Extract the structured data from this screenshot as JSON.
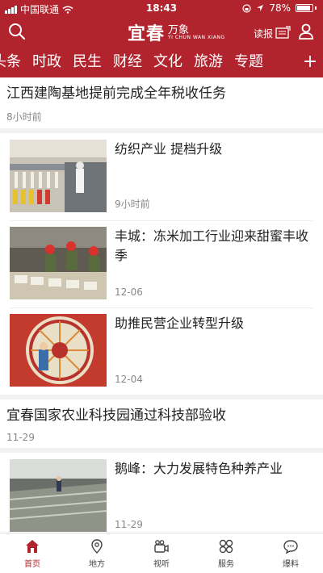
{
  "status": {
    "carrier": "中国联通",
    "time": "18:43",
    "battery": "78%",
    "battery_level": 0.78
  },
  "header": {
    "logo_main": "宜春",
    "logo_sub": "万象",
    "logo_en": "YI CHUN WAN XIANG",
    "read_label": "读报"
  },
  "tabs": {
    "items": [
      "头条",
      "时政",
      "民生",
      "财经",
      "文化",
      "旅游",
      "专题"
    ],
    "active": "财经",
    "plus": "+"
  },
  "feed": {
    "top_item": {
      "title": "江西建陶基地提前完成全年税收任务",
      "time": "8小时前"
    },
    "group1": [
      {
        "title": "纺织产业 提档升级",
        "time": "9小时前"
      },
      {
        "title": "丰城：冻米加工行业迎来甜蜜丰收季",
        "time": "12-06"
      },
      {
        "title": "助推民营企业转型升级",
        "time": "12-04"
      }
    ],
    "mid_item": {
      "title": "宜春国家农业科技园通过科技部验收",
      "time": "11-29"
    },
    "group2": [
      {
        "title": "鹅峰：大力发展特色种养产业",
        "time": "11-29"
      }
    ]
  },
  "bottom_nav": [
    {
      "label": "首页",
      "icon": "home-icon"
    },
    {
      "label": "地方",
      "icon": "location-icon"
    },
    {
      "label": "视听",
      "icon": "video-camera-icon"
    },
    {
      "label": "服务",
      "icon": "grid-icon"
    },
    {
      "label": "爆料",
      "icon": "chat-icon"
    }
  ],
  "colors": {
    "brand": "#b2242d",
    "text": "#222222",
    "meta": "#888888"
  }
}
